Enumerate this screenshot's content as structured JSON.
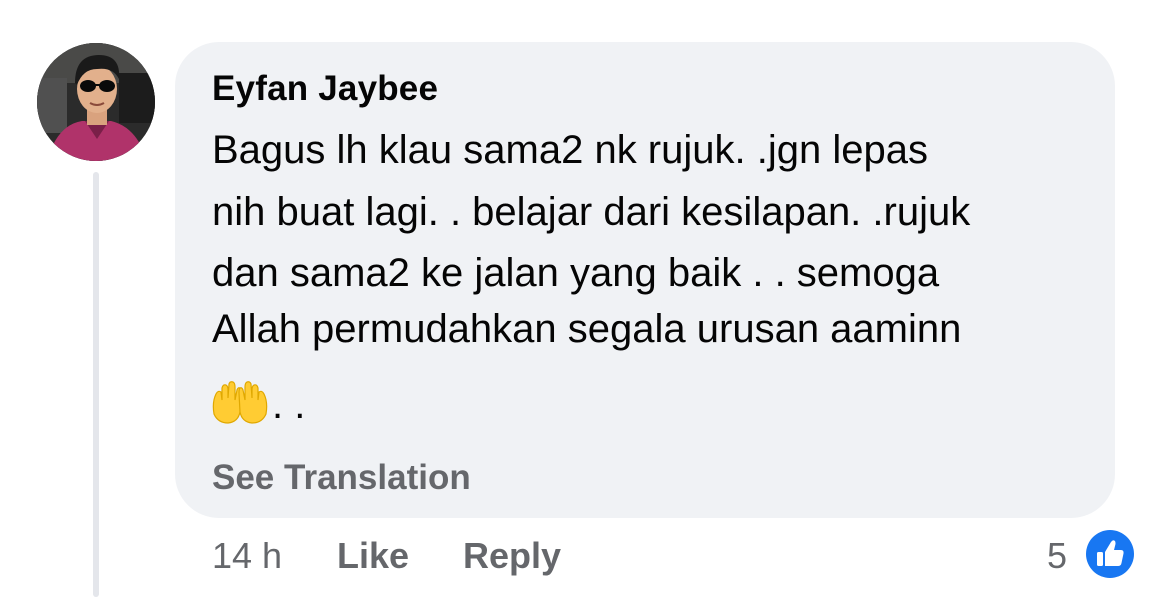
{
  "comment": {
    "author": "Eyfan Jaybee",
    "lines": [
      "Bagus lh klau sama2 nk rujuk. .jgn lepas",
      "nih buat lagi. . belajar dari kesilapan. .rujuk",
      "dan sama2 ke jalan yang baik . . semoga",
      "Allah permudahkan segala urusan aaminn"
    ],
    "emoji_icon": "raised-hands-icon",
    "trailing_dots": ". .",
    "see_translation": "See Translation"
  },
  "actions": {
    "time": "14 h",
    "like": "Like",
    "reply": "Reply"
  },
  "reactions": {
    "count": "5",
    "icon": "thumbs-up-icon",
    "color": "#1877f2"
  },
  "colors": {
    "bubble": "#f0f2f5",
    "text": "#050505",
    "secondary": "#65676b",
    "thread_line": "#e4e6eb"
  }
}
